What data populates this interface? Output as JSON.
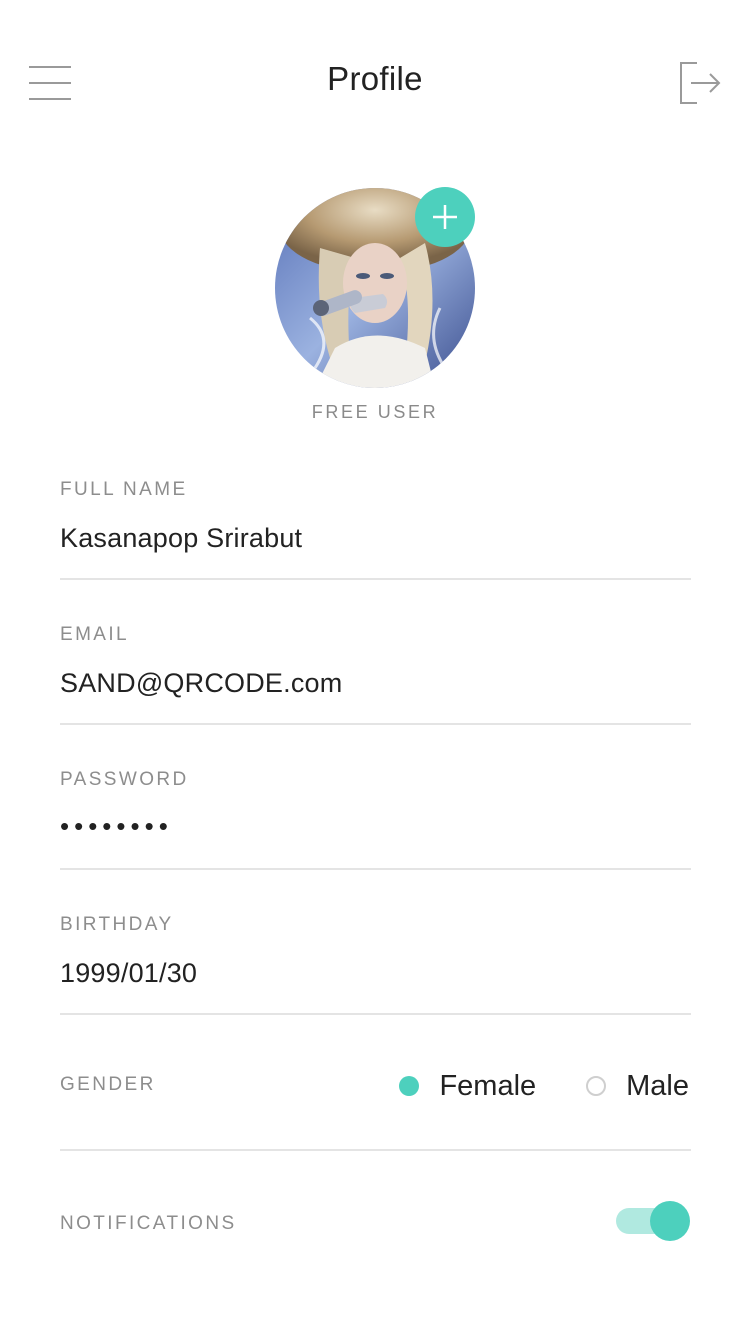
{
  "header": {
    "title": "Profile",
    "menu_icon": "hamburger-menu-icon",
    "logout_icon": "logout-arrow-icon"
  },
  "profile": {
    "tier": "FREE USER",
    "add_photo_icon": "plus-icon"
  },
  "fields": {
    "full_name": {
      "label": "FULL NAME",
      "value": "Kasanapop Srirabut"
    },
    "email": {
      "label": "EMAIL",
      "value": "SAND@QRCODE.com"
    },
    "password": {
      "label": "PASSWORD",
      "value": "••••••••"
    },
    "birthday": {
      "label": "BIRTHDAY",
      "value": "1999/01/30"
    }
  },
  "gender": {
    "label": "GENDER",
    "options": [
      {
        "label": "Female",
        "selected": true
      },
      {
        "label": "Male",
        "selected": false
      }
    ]
  },
  "notifications": {
    "label": "NOTIFICATIONS",
    "enabled": true
  },
  "colors": {
    "accent": "#4dd0bd",
    "accent_light": "#b0e9e0",
    "label_gray": "#8d8d8d",
    "divider": "#e4e4e4"
  }
}
